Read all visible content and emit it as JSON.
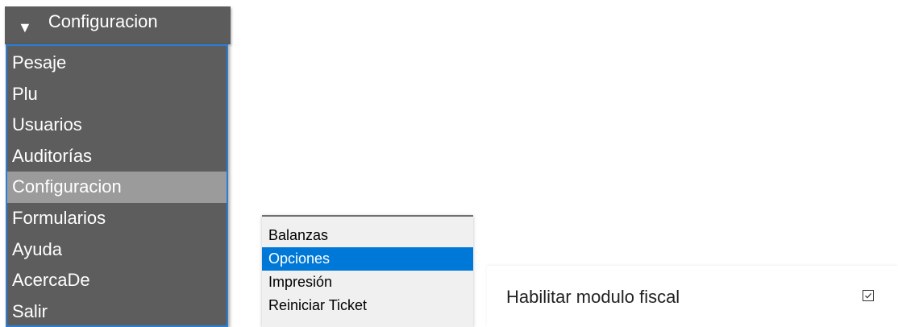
{
  "main_menu": {
    "header": {
      "title": "Configuracion",
      "icon": "triangle-down-icon",
      "glyph": "▼"
    },
    "items": [
      {
        "label": "Pesaje"
      },
      {
        "label": "Plu"
      },
      {
        "label": "Usuarios"
      },
      {
        "label": "Auditorías"
      },
      {
        "label": "Configuracion",
        "selected": true
      },
      {
        "label": "Formularios"
      },
      {
        "label": "Ayuda"
      },
      {
        "label": "AcercaDe"
      },
      {
        "label": "Salir"
      }
    ]
  },
  "submenu": {
    "items": [
      {
        "label": "Balanzas"
      },
      {
        "label": "Opciones",
        "selected": true
      },
      {
        "label": "Impresión"
      },
      {
        "label": "Reiniciar Ticket"
      }
    ]
  },
  "fiscal_option": {
    "label": "Habilitar modulo fiscal",
    "checked": true,
    "icon": "checkbox-checked-icon"
  },
  "colors": {
    "menu_bg": "#5d5d5d",
    "menu_selected": "#9b9b9b",
    "menu_border": "#2a7fd4",
    "submenu_bg": "#f0f0f0",
    "submenu_selected": "#0078d7"
  }
}
